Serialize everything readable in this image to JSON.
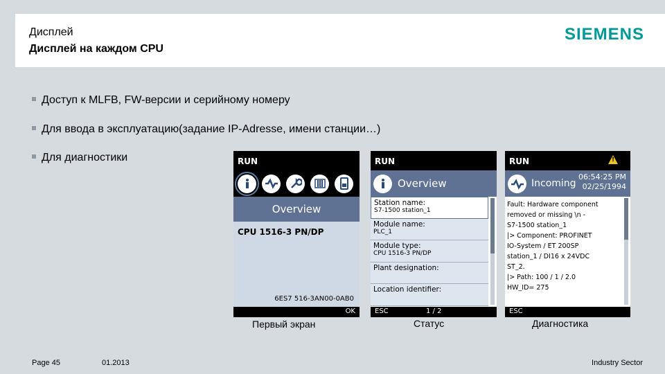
{
  "header": {
    "title_line1": "Дисплей",
    "title_line2": "Дисплей на каждом CPU",
    "logo": "SIEMENS",
    "brand_color": "#009999"
  },
  "bullets": [
    "Доступ к MLFB, FW-версии и серийному номеру",
    "Для ввода в эксплуатацию(задание  IP-Adresse, имени станции…)",
    "Для диагностики"
  ],
  "screen1": {
    "status": "RUN",
    "icons": [
      "info-icon",
      "diagnostics-icon",
      "wrench-icon",
      "module-icon",
      "display-settings-icon"
    ],
    "title": "Overview",
    "cpu": "CPU 1516-3 PN/DP",
    "mlfb": "6ES7 516-3AN00-0AB0",
    "softkey": "OK",
    "caption": "Первый экран"
  },
  "screen2": {
    "status": "RUN",
    "title": "Overview",
    "rows": [
      {
        "label": "Station name:",
        "value": "S7-1500 station_1"
      },
      {
        "label": "Module name:",
        "value": "PLC_1"
      },
      {
        "label": "Module type:",
        "value": "CPU 1516-3 PN/DP"
      },
      {
        "label": "Plant designation:",
        "value": ""
      },
      {
        "label": "Location identifier:",
        "value": ""
      }
    ],
    "softkey": "ESC",
    "page": "1 / 2",
    "caption": "Статус"
  },
  "screen3": {
    "status": "RUN",
    "warning_symbol": "!",
    "title": "Incoming",
    "time": "06:54:25 PM",
    "date": "02/25/1994",
    "lines": [
      "Fault: Hardware component",
      "removed or missing  \\n -",
      "S7-1500 station_1",
      "|> Component: PROFINET",
      "IO-System / ET 200SP",
      "station_1 / DI16 x 24VDC",
      "ST_2.",
      "|> Path: 100 / 1 / 2.0",
      "HW_ID= 275"
    ],
    "softkey": "ESC",
    "caption": "Диагностика"
  },
  "footer": {
    "page": "Page 45",
    "date": "01.2013",
    "sector": "Industry Sector"
  }
}
